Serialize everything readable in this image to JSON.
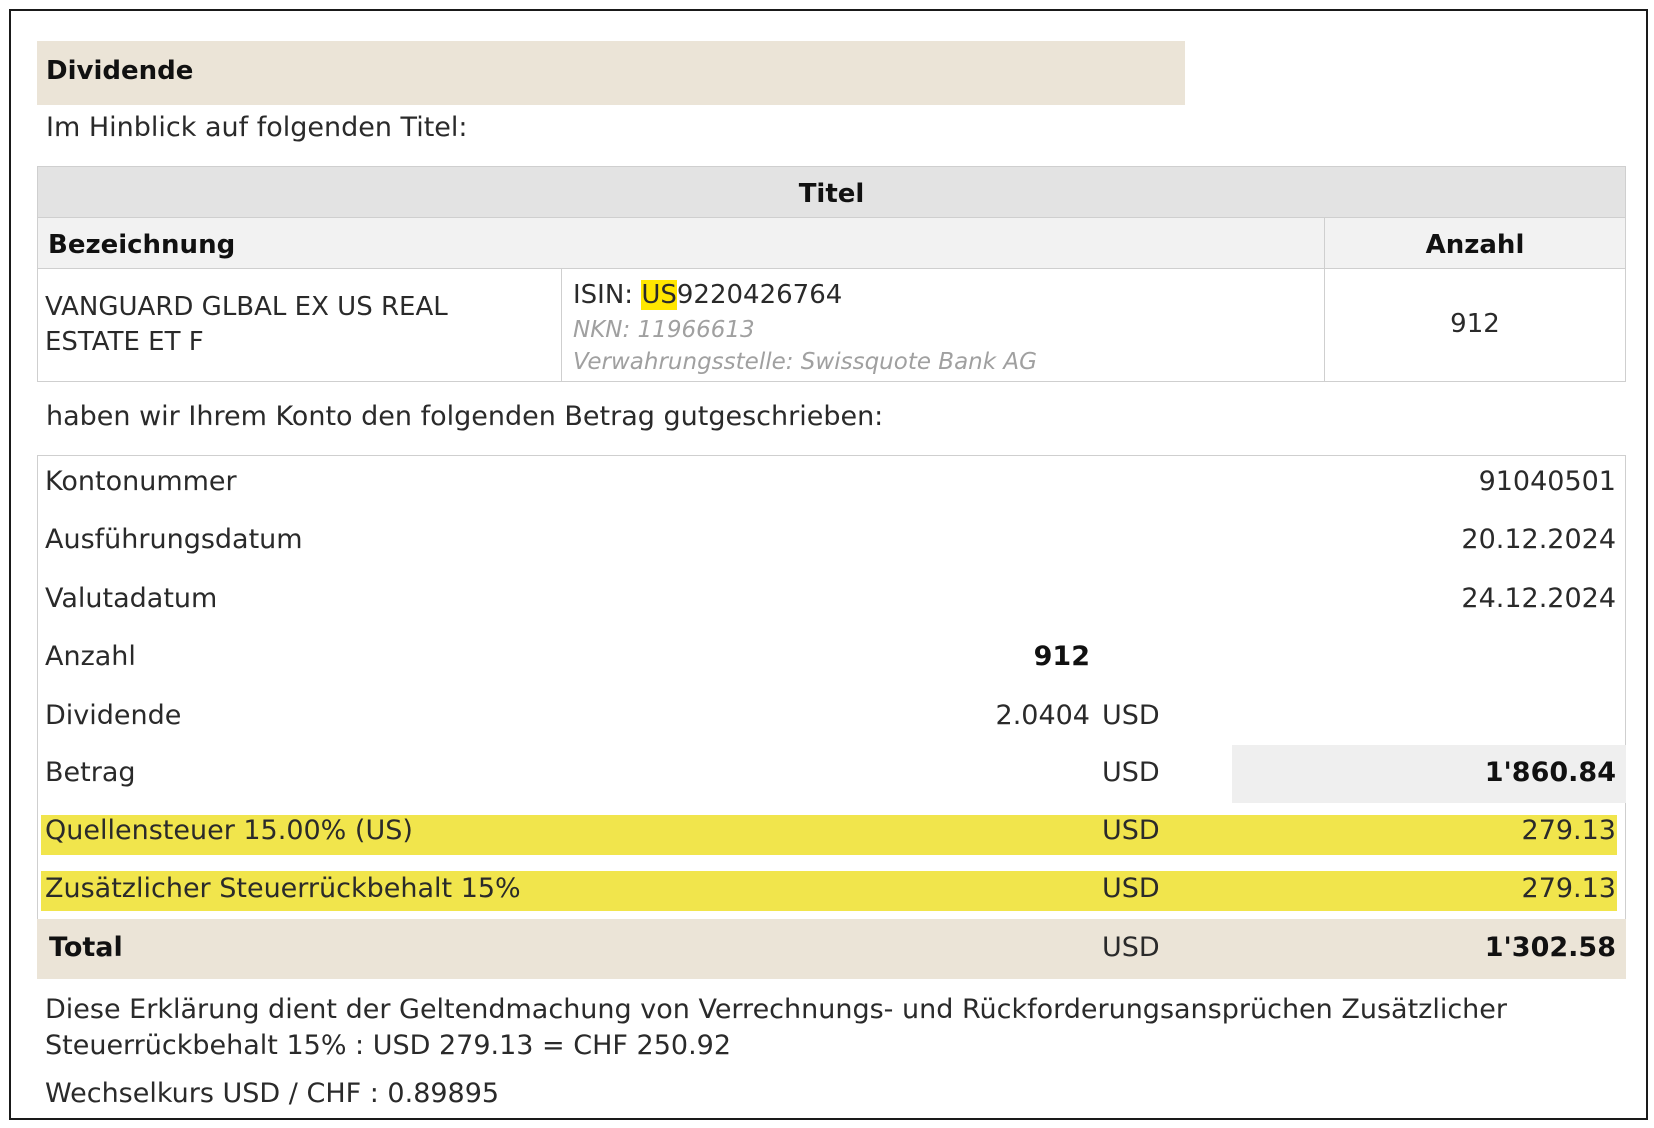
{
  "section": {
    "title": "Dividende"
  },
  "intro": "Im Hinblick auf folgenden Titel:",
  "title_table": {
    "header": "Titel",
    "col_designation": "Bezeichnung",
    "col_quantity": "Anzahl",
    "security_name_line1": "VANGUARD GLBAL EX US REAL",
    "security_name_line2": "ESTATE ET F",
    "isin_label": "ISIN: ",
    "isin_country": "US",
    "isin_rest": "9220426764",
    "nkn": "NKN: 11966613",
    "custodian": "Verwahrungsstelle: Swissquote Bank AG",
    "quantity": "912"
  },
  "credit_intro": "haben wir Ihrem Konto den folgenden Betrag gutgeschrieben:",
  "details": {
    "account_label": "Kontonummer",
    "account_value": "91040501",
    "execution_label": "Ausführungsdatum",
    "execution_value": "20.12.2024",
    "value_date_label": "Valutadatum",
    "value_date_value": "24.12.2024",
    "quantity_label": "Anzahl",
    "quantity_value": "912",
    "dividend_label": "Dividende",
    "dividend_value": "2.0404",
    "dividend_currency": "USD",
    "amount_label": "Betrag",
    "amount_currency": "USD",
    "amount_value": "1'860.84",
    "withholding_label": "Quellensteuer 15.00% (US)",
    "withholding_currency": "USD",
    "withholding_value": "279.13",
    "additional_label": "Zusätzlicher Steuerrückbehalt 15%",
    "additional_currency": "USD",
    "additional_value": "279.13",
    "total_label": "Total",
    "total_currency": "USD",
    "total_value": "1'302.58"
  },
  "notes": {
    "line1": "Diese Erklärung dient der Geltendmachung von Verrechnungs- und Rückforderungsansprüchen Zusätzlicher",
    "line2": "Steuerrückbehalt 15% : USD 279.13 = CHF 250.92",
    "exchange_rate": "Wechselkurs USD / CHF : 0.89895"
  },
  "colors": {
    "header_beige": "#ebe4d7",
    "highlight_yellow": "#f1e54c",
    "isin_highlight": "#ffe600",
    "table_header_grey": "#e3e3e3"
  }
}
